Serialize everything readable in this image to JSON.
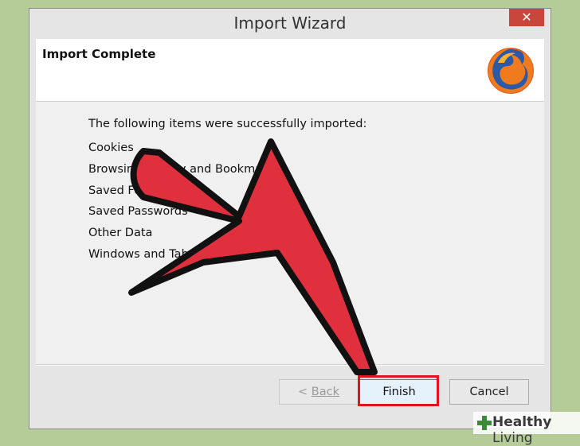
{
  "window": {
    "title": "Import Wizard",
    "close_glyph": "✕"
  },
  "header": {
    "title": "Import Complete",
    "logo_icon": "firefox-logo-icon"
  },
  "content": {
    "intro": "The following items were successfully imported:",
    "items": [
      {
        "label": "Cookies"
      },
      {
        "label": "Browsing History and Bookmarks"
      },
      {
        "label": "Saved Form History"
      },
      {
        "label": "Saved Passwords"
      },
      {
        "label": "Other Data"
      },
      {
        "label": "Windows and Tabs"
      }
    ]
  },
  "buttons": {
    "back_prefix": "< ",
    "back_label": "Back",
    "finish_label": "Finish",
    "cancel_label": "Cancel"
  },
  "overlay": {
    "arrow_color": "#e0303e",
    "highlight_color": "#e0141e"
  },
  "watermark": {
    "brand": "Healthy",
    "brand_suffix": " Living"
  }
}
